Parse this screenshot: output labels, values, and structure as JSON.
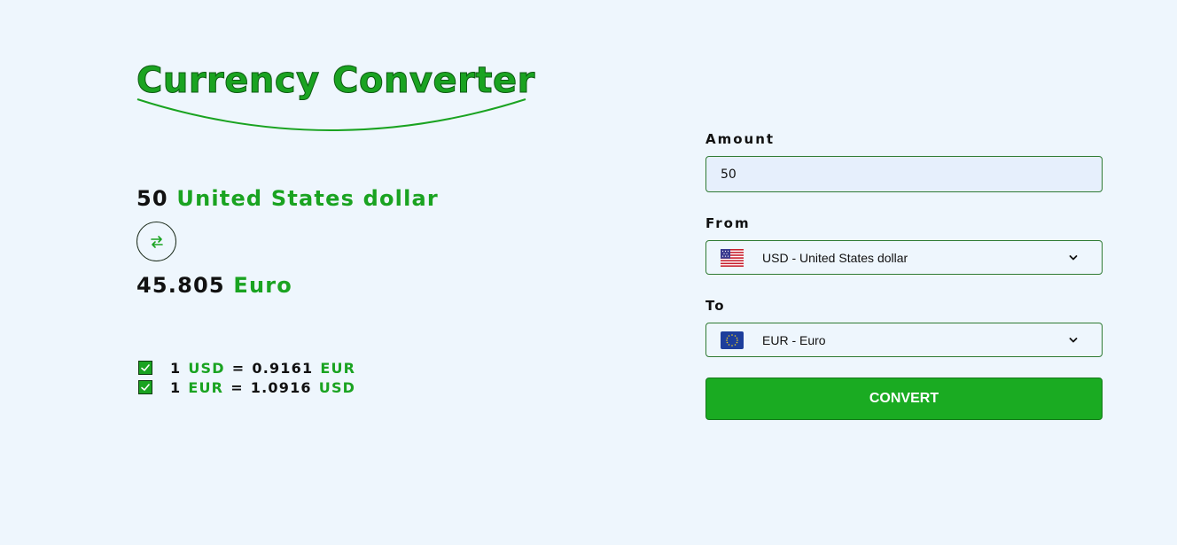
{
  "app": {
    "title": "Currency Converter"
  },
  "summary": {
    "amount": "50",
    "from_name": "United States dollar",
    "result": "45.805",
    "to_name": "Euro"
  },
  "rates": [
    {
      "one": "1",
      "from": "USD",
      "eq": "=",
      "value": "0.9161",
      "to": "EUR"
    },
    {
      "one": "1",
      "from": "EUR",
      "eq": "=",
      "value": "1.0916",
      "to": "USD"
    }
  ],
  "form": {
    "amount_label": "Amount",
    "amount_value": "50",
    "from_label": "From",
    "from_selected": "USD - United States dollar",
    "from_flag": "us-flag",
    "to_label": "To",
    "to_selected": "EUR - Euro",
    "to_flag": "eu-flag",
    "convert_label": "CONVERT"
  },
  "colors": {
    "accent": "#1aa321",
    "button": "#1aab22",
    "background": "#eef6fd",
    "input_bg": "#e6effc",
    "border": "#2f7a33"
  },
  "icons": {
    "swap": "swap-arrows-icon",
    "check": "checkbox-check-icon",
    "chevron": "chevron-down-icon"
  }
}
